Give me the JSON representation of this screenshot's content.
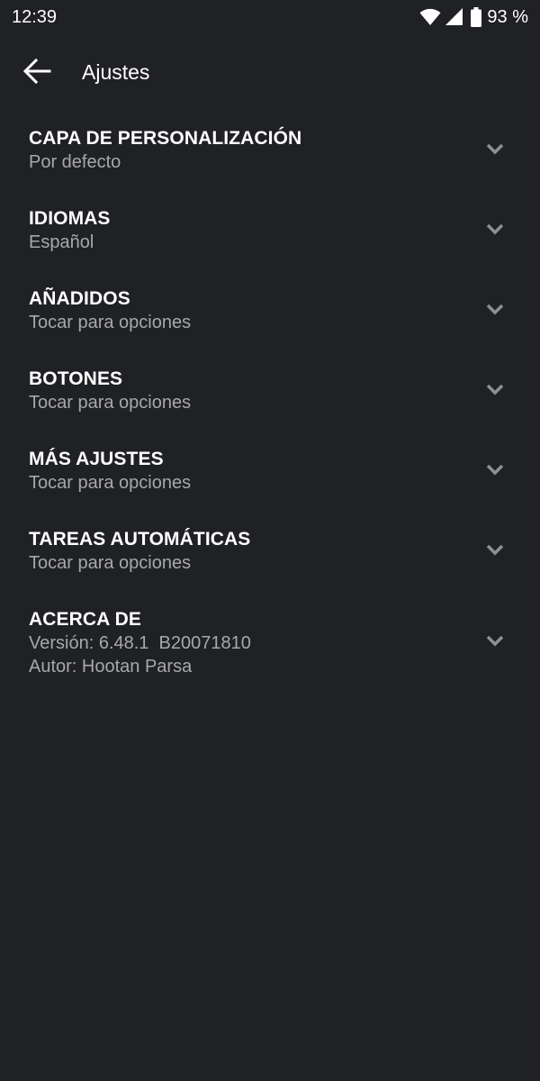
{
  "status_bar": {
    "time": "12:39",
    "battery_percent": "93 %",
    "icons": [
      "wifi-icon",
      "signal-icon",
      "battery-icon"
    ]
  },
  "app_bar": {
    "back_icon": "arrow-left-icon",
    "title": "Ajustes"
  },
  "colors": {
    "background": "#202125",
    "title_text": "#ffffff",
    "subtitle_text": "#a7a8ac",
    "chevron": "#8e8f93"
  },
  "settings": [
    {
      "title": "CAPA DE PERSONALIZACIÓN",
      "subtitles": [
        "Por defecto"
      ]
    },
    {
      "title": "IDIOMAS",
      "subtitles": [
        "Español"
      ]
    },
    {
      "title": "AÑADIDOS",
      "subtitles": [
        "Tocar para opciones"
      ]
    },
    {
      "title": "BOTONES",
      "subtitles": [
        "Tocar para opciones"
      ]
    },
    {
      "title": "MÁS AJUSTES",
      "subtitles": [
        "Tocar para opciones"
      ]
    },
    {
      "title": "TAREAS AUTOMÁTICAS",
      "subtitles": [
        "Tocar para opciones"
      ]
    },
    {
      "title": "ACERCA DE",
      "subtitles": [
        "Versión: 6.48.1  B20071810",
        "Autor: Hootan Parsa"
      ]
    }
  ]
}
